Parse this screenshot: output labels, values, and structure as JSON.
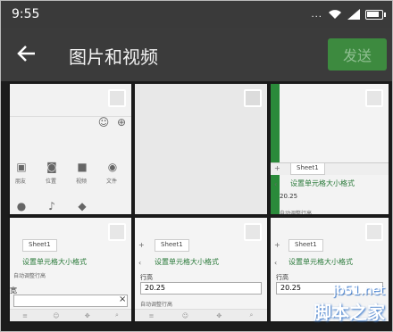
{
  "status": {
    "time": "9:55",
    "signal": "..."
  },
  "topbar": {
    "title": "图片和视频",
    "send_label": "发送"
  },
  "tiles": [
    {
      "labels": [
        "朋友",
        "位置",
        "视频",
        "文件"
      ]
    },
    {},
    {
      "sheet": "Sheet1",
      "setting": "设置单元格大小格式",
      "value": "20.25",
      "auto": "自动调整行高"
    },
    {
      "sheet": "Sheet1",
      "setting": "设置单元格大小格式",
      "auto": "自动调整行高",
      "row_label": "宽"
    },
    {
      "sheet": "Sheet1",
      "setting": "设置单元格大小格式",
      "field_label": "行高",
      "value": "20.25",
      "auto": "自动调整行高"
    },
    {
      "sheet": "Sheet1",
      "setting": "设置单元格大小格式",
      "field_label": "行高",
      "value": "20.25"
    }
  ],
  "watermark": {
    "site": "jb51.net",
    "name": "脚本之家"
  }
}
